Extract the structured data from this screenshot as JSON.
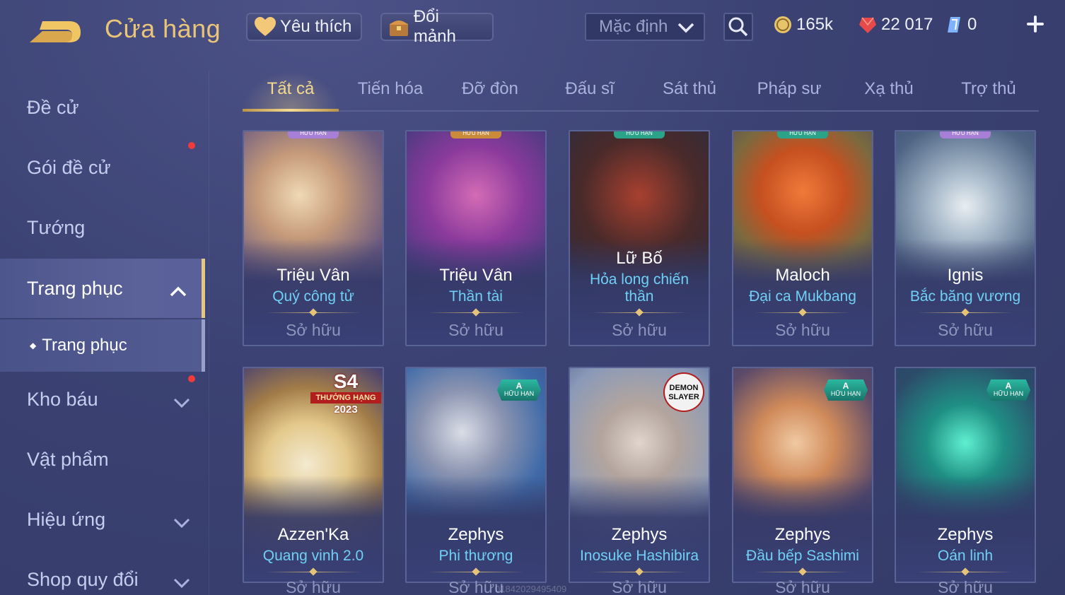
{
  "header": {
    "title": "Cửa hàng",
    "favorites_label": "Yêu thích",
    "exchange_label": "Đổi mảnh",
    "sort_value": "Mặc định",
    "currencies": [
      {
        "name": "gold",
        "value": "165k",
        "color": "#e7c46c"
      },
      {
        "name": "vouchers",
        "value": "22 017",
        "color": "#e84a4a"
      },
      {
        "name": "quan-huy",
        "value": "0",
        "color": "#7fb2ff"
      }
    ]
  },
  "sidebar": {
    "items": [
      {
        "label": "Đề cử"
      },
      {
        "label": "Gói đề cử"
      },
      {
        "label": "Tướng"
      },
      {
        "label": "Trang phục"
      },
      {
        "label": "Trang phục"
      },
      {
        "label": "Kho báu"
      },
      {
        "label": "Vật phẩm"
      },
      {
        "label": "Hiệu ứng"
      },
      {
        "label": "Shop quy đổi"
      }
    ]
  },
  "tabs": [
    {
      "label": "Tất cả"
    },
    {
      "label": "Tiến hóa"
    },
    {
      "label": "Đỡ đòn"
    },
    {
      "label": "Đấu sĩ"
    },
    {
      "label": "Sát thủ"
    },
    {
      "label": "Pháp sư"
    },
    {
      "label": "Xạ thủ"
    },
    {
      "label": "Trợ thủ"
    }
  ],
  "cards": [
    {
      "hero": "Triệu Vân",
      "skin": "Quý công tử",
      "status": "Sở hữu",
      "tag": "HỮU HẠN"
    },
    {
      "hero": "Triệu Vân",
      "skin": "Thần tài",
      "status": "Sở hữu",
      "tag": "HỮU HẠN"
    },
    {
      "hero": "Lữ Bố",
      "skin": "Hỏa long chiến thần",
      "status": "Sở hữu",
      "tag": "HỮU HẠN"
    },
    {
      "hero": "Maloch",
      "skin": "Đại ca Mukbang",
      "status": "Sở hữu",
      "tag": "HỮU HẠN"
    },
    {
      "hero": "Ignis",
      "skin": "Bắc băng vương",
      "status": "Sở hữu",
      "tag": "HỮU HẠN"
    },
    {
      "hero": "Azzen'Ka",
      "skin": "Quang vinh 2.0",
      "status": "Sở hữu",
      "tag": "S4",
      "tag2": "THƯỞNG HẠNG",
      "tag3": "2023"
    },
    {
      "hero": "Zephys",
      "skin": "Phi thương",
      "status": "Sở hữu",
      "tag": "A",
      "tag2": "HỮU HẠN"
    },
    {
      "hero": "Zephys",
      "skin": "Inosuke Hashibira",
      "status": "Sở hữu",
      "tag": "DEMON SLAYER"
    },
    {
      "hero": "Zephys",
      "skin": "Đầu bếp Sashimi",
      "status": "Sở hữu",
      "tag": "A",
      "tag2": "HỮU HẠN"
    },
    {
      "hero": "Zephys",
      "skin": "Oán linh",
      "status": "Sở hữu",
      "tag": "A",
      "tag2": "HỮU HẠN"
    }
  ],
  "watermark": "01842029495409"
}
